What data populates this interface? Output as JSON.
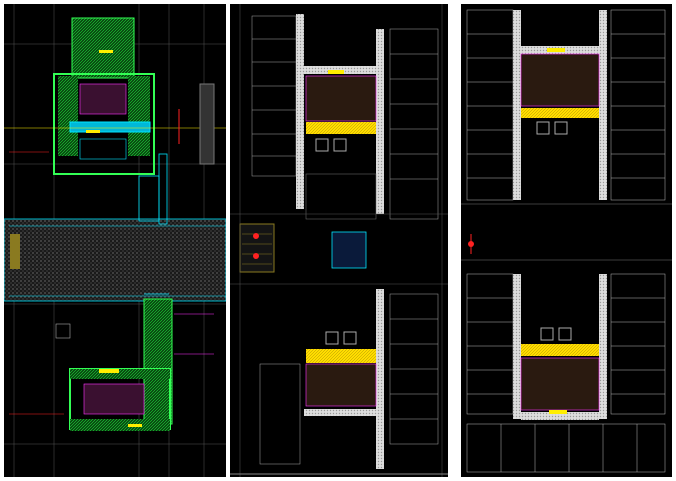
{
  "panels": [
    {
      "id": "left",
      "description": ""
    },
    {
      "id": "middle",
      "description": ""
    },
    {
      "id": "right",
      "description": ""
    }
  ],
  "colors": {
    "background": "#000000",
    "wall": "#ffffff",
    "line_green": "#00ff33",
    "line_cyan": "#00e5ff",
    "line_magenta": "#ff33ff",
    "line_yellow": "#ffee00",
    "line_red": "#ff2222",
    "grid_gray": "#666666",
    "hatch_gray": "#9a9a9a",
    "olive": "#8a7a20"
  },
  "room_tag": "",
  "notes": ""
}
